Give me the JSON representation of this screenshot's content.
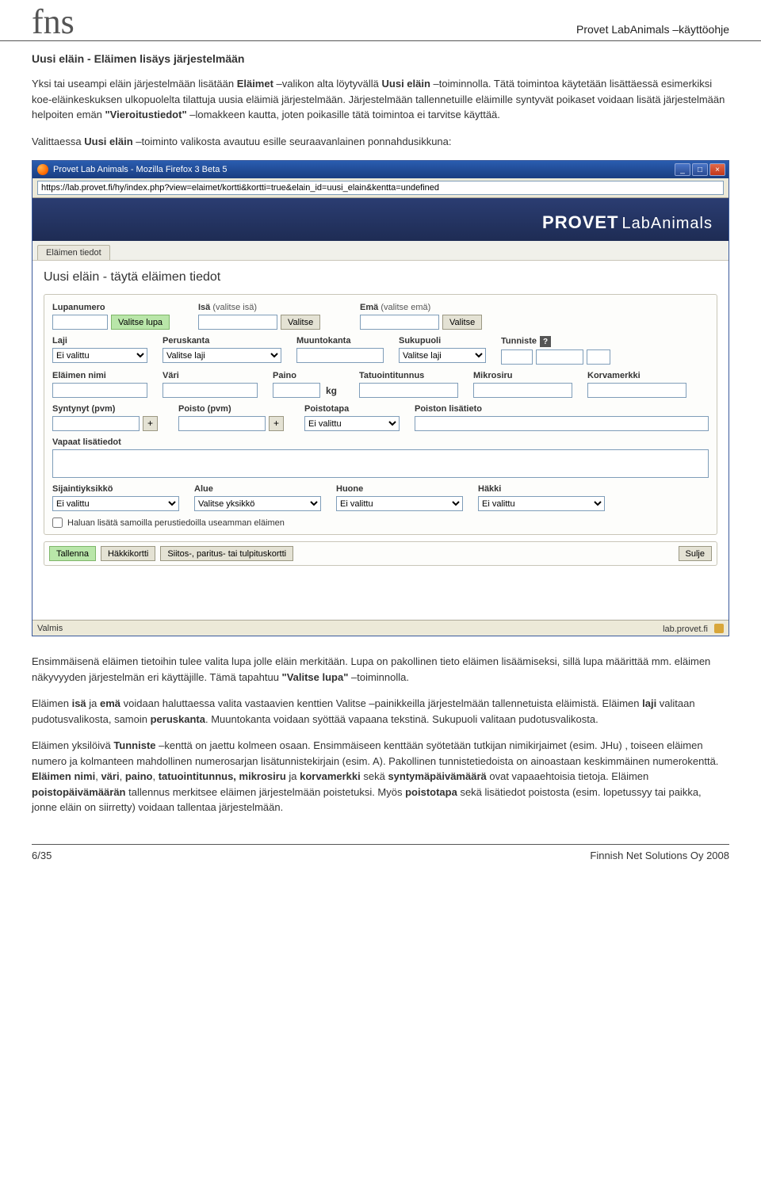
{
  "doc": {
    "logo": "fns",
    "header_title": "Provet LabAnimals –käyttöohje",
    "section_heading": "Uusi eläin - Eläimen lisäys järjestelmään",
    "para1_a": "Yksi tai useampi eläin järjestelmään lisätään ",
    "para1_b1": "Eläimet",
    "para1_c": " –valikon alta löytyvällä ",
    "para1_b2": "Uusi eläin",
    "para1_d": " –toiminnolla. Tätä toimintoa käytetään lisättäessä esimerkiksi koe-eläinkeskuksen ulkopuolelta tilattuja uusia eläimiä järjestelmään. Järjestelmään tallennetuille eläimille syntyvät poikaset voidaan lisätä järjestelmään helpoiten emän ",
    "para1_b3": "\"Vieroitustiedot\"",
    "para1_e": " –lomakkeen kautta, joten poikasille tätä toimintoa ei tarvitse käyttää.",
    "para2_a": "Valittaessa ",
    "para2_b": "Uusi eläin",
    "para2_c": " –toiminto valikosta avautuu esille seuraavanlainen ponnahdusikkuna:",
    "para3": "Ensimmäisenä eläimen tietoihin tulee valita lupa jolle eläin merkitään. Lupa on pakollinen tieto eläimen lisäämiseksi, sillä lupa määrittää mm. eläimen näkyvyyden järjestelmän eri käyttäjille. Tämä tapahtuu ",
    "para3_b": "\"Valitse lupa\"",
    "para3_c": " –toiminnolla.",
    "para4_a": "Eläimen ",
    "para4_b1": "isä",
    "para4_c": " ja ",
    "para4_b2": "emä",
    "para4_d": " voidaan haluttaessa valita vastaavien kenttien Valitse –painikkeilla järjestelmään tallennetuista eläimistä. Eläimen ",
    "para4_b3": "laji",
    "para4_e": " valitaan pudotusvalikosta, samoin ",
    "para4_b4": "peruskanta",
    "para4_f": ". Muuntokanta voidaan syöttää vapaana tekstinä.  Sukupuoli valitaan pudotusvalikosta.",
    "para5_a": "Eläimen yksilöivä ",
    "para5_b1": "Tunniste",
    "para5_c": " –kenttä on jaettu kolmeen osaan. Ensimmäiseen kenttään syötetään tutkijan nimikirjaimet (esim. JHu) , toiseen eläimen numero ja kolmanteen mahdollinen numerosarjan lisätunnistekirjain (esim. A). Pakollinen tunnistetiedoista on ainoastaan keskimmäinen numerokenttä. ",
    "para5_b2": "Eläimen nimi",
    "para5_d": ", ",
    "para5_b3": "väri",
    "para5_e": ", ",
    "para5_b4": "paino",
    "para5_f": ", ",
    "para5_b5": "tatuointitunnus, mikrosiru",
    "para5_g": " ja ",
    "para5_b6": "korvamerkki",
    "para5_h": " sekä ",
    "para5_b7": "syntymäpäivämäärä",
    "para5_i": " ovat vapaaehtoisia tietoja. Eläimen ",
    "para5_b8": "poistopäivämäärän",
    "para5_j": " tallennus merkitsee eläimen järjestelmään poistetuksi. Myös ",
    "para5_b9": "poistotapa",
    "para5_k": " sekä lisätiedot poistosta (esim. lopetussyy tai paikka, jonne eläin on siirretty) voidaan tallentaa järjestelmään.",
    "footer_left": "6/35",
    "footer_right": "Finnish Net Solutions Oy 2008"
  },
  "ff": {
    "title": "Provet Lab Animals - Mozilla Firefox 3 Beta 5",
    "url": "https://lab.provet.fi/hy/index.php?view=elaimet/kortti&kortti=true&elain_id=uusi_elain&kentta=undefined",
    "banner_brand": "PROVET",
    "banner_sub": "LabAnimals",
    "tab": "Eläimen tiedot",
    "form_title": "Uusi eläin - täytä eläimen tiedot",
    "labels": {
      "lupanumero": "Lupanumero",
      "isa": "Isä",
      "isa_hint": "(valitse isä)",
      "ema": "Emä",
      "ema_hint": "(valitse emä)",
      "laji": "Laji",
      "peruskanta": "Peruskanta",
      "muuntokanta": "Muuntokanta",
      "sukupuoli": "Sukupuoli",
      "tunniste": "Tunniste",
      "elaimen_nimi": "Eläimen nimi",
      "vari": "Väri",
      "paino": "Paino",
      "tatuointi": "Tatuointitunnus",
      "mikrosiru": "Mikrosiru",
      "korvamerkki": "Korvamerkki",
      "syntynyt": "Syntynyt (pvm)",
      "poisto": "Poisto (pvm)",
      "poistotapa": "Poistotapa",
      "poiston_lisa": "Poiston lisätieto",
      "vapaat": "Vapaat lisätiedot",
      "sijainti": "Sijaintiyksikkö",
      "alue": "Alue",
      "huone": "Huone",
      "hakki": "Häkki",
      "checkbox": "Haluan lisätä samoilla perustiedoilla useamman eläimen"
    },
    "buttons": {
      "valitse_lupa": "Valitse lupa",
      "valitse": "Valitse",
      "tallenna": "Tallenna",
      "hakkikortti": "Häkkikortti",
      "siitos": "Siitos-, paritus- tai tulpituskortti",
      "sulje": "Sulje"
    },
    "selects": {
      "ei_valittu": "Ei valittu",
      "valitse_laji": "Valitse laji",
      "valitse_yksikko": "Valitse yksikkö"
    },
    "kg": "kg",
    "status_left": "Valmis",
    "status_right": "lab.provet.fi"
  }
}
